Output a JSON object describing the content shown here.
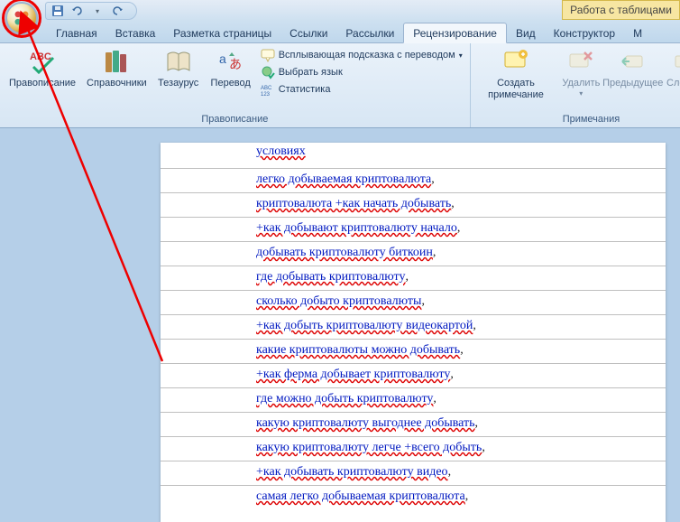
{
  "titlebar": {
    "context_tab": "Работа с таблицами"
  },
  "tabs": {
    "items": [
      "Главная",
      "Вставка",
      "Разметка страницы",
      "Ссылки",
      "Рассылки",
      "Рецензирование",
      "Вид",
      "Конструктор",
      "М"
    ],
    "active_index": 5
  },
  "ribbon": {
    "group1": {
      "label": "Правописание",
      "spelling": "Правописание",
      "references": "Справочники",
      "thesaurus": "Тезаурус",
      "translate": "Перевод",
      "tooltip": "Всплывающая подсказка с переводом",
      "setlang": "Выбрать язык",
      "stats": "Статистика"
    },
    "group2": {
      "label": "Примечания",
      "new_comment": "Создать примечание",
      "delete": "Удалить",
      "prev": "Предыдущее",
      "next": "Следую"
    }
  },
  "document": {
    "rows": [
      "условиях",
      "легко добываемая криптовалюта",
      "криптовалюта +как начать добывать",
      "+как добывают криптовалюту начало",
      "добывать криптовалюту биткоин",
      "где добывать криптовалюту",
      "сколько добыто криптовалюты",
      "+как добыть криптовалюту видеокартой",
      "какие криптовалюты можно добывать",
      "+как ферма добывает криптовалюту",
      "где можно добыть криптовалюту",
      "какую криптовалюту выгоднее добывать",
      "какую криптовалюту легче +всего добыть",
      "+как добывать криптовалюту видео",
      "самая легко добываемая криптовалюта"
    ],
    "trailing_comma": ","
  },
  "ruler_corner": "L"
}
